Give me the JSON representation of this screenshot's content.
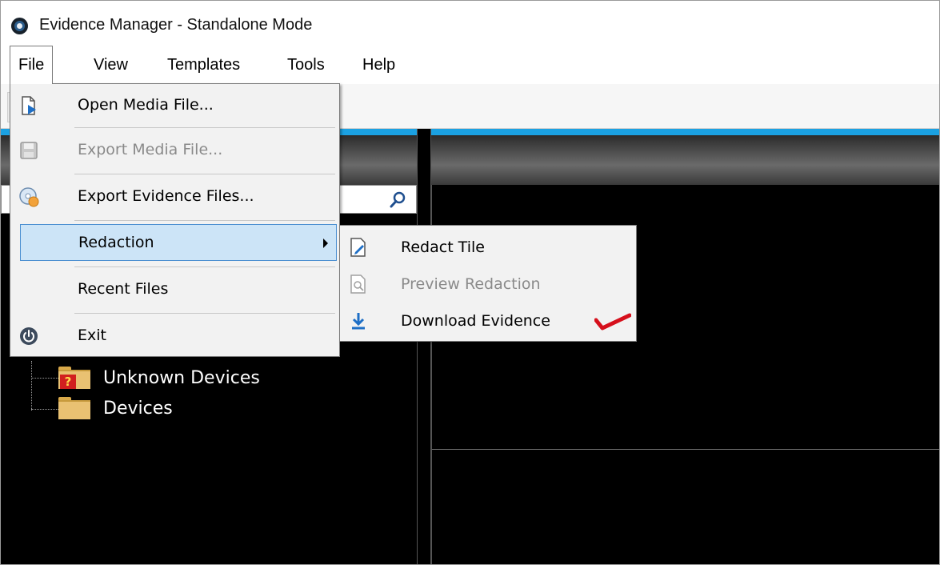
{
  "window": {
    "title": "Evidence Manager - Standalone Mode"
  },
  "menubar": {
    "items": [
      {
        "label": "File"
      },
      {
        "label": "View"
      },
      {
        "label": "Templates"
      },
      {
        "label": "Tools"
      },
      {
        "label": "Help"
      }
    ]
  },
  "file_menu": {
    "items": [
      {
        "label": "Open Media File...",
        "icon": "open-media-icon",
        "enabled": true
      },
      {
        "label": "Export Media File...",
        "icon": "save-disk-icon",
        "enabled": false
      },
      {
        "label": "Export Evidence Files...",
        "icon": "disc-export-icon",
        "enabled": true
      },
      {
        "label": "Redaction",
        "icon": "",
        "enabled": true,
        "highlighted": true,
        "has_submenu": true
      },
      {
        "label": "Recent Files",
        "icon": "",
        "enabled": true
      },
      {
        "label": "Exit",
        "icon": "power-icon",
        "enabled": true
      }
    ]
  },
  "redaction_submenu": {
    "items": [
      {
        "label": "Redact Tile",
        "icon": "redact-pen-icon",
        "enabled": true
      },
      {
        "label": "Preview Redaction",
        "icon": "preview-magnifier-icon",
        "enabled": false
      },
      {
        "label": "Download Evidence",
        "icon": "download-arrow-icon",
        "enabled": true,
        "annotation": "red-check-mark"
      }
    ]
  },
  "tree": {
    "items": [
      {
        "label": "Unknown Devices",
        "icon": "unknown-folder-icon"
      },
      {
        "label": "Devices",
        "icon": "folder-icon"
      }
    ]
  },
  "colors": {
    "accent": "#1ba1e2",
    "highlight_bg": "#cce4f7",
    "highlight_border": "#4b8fd1",
    "annotation_red": "#d6101c"
  }
}
